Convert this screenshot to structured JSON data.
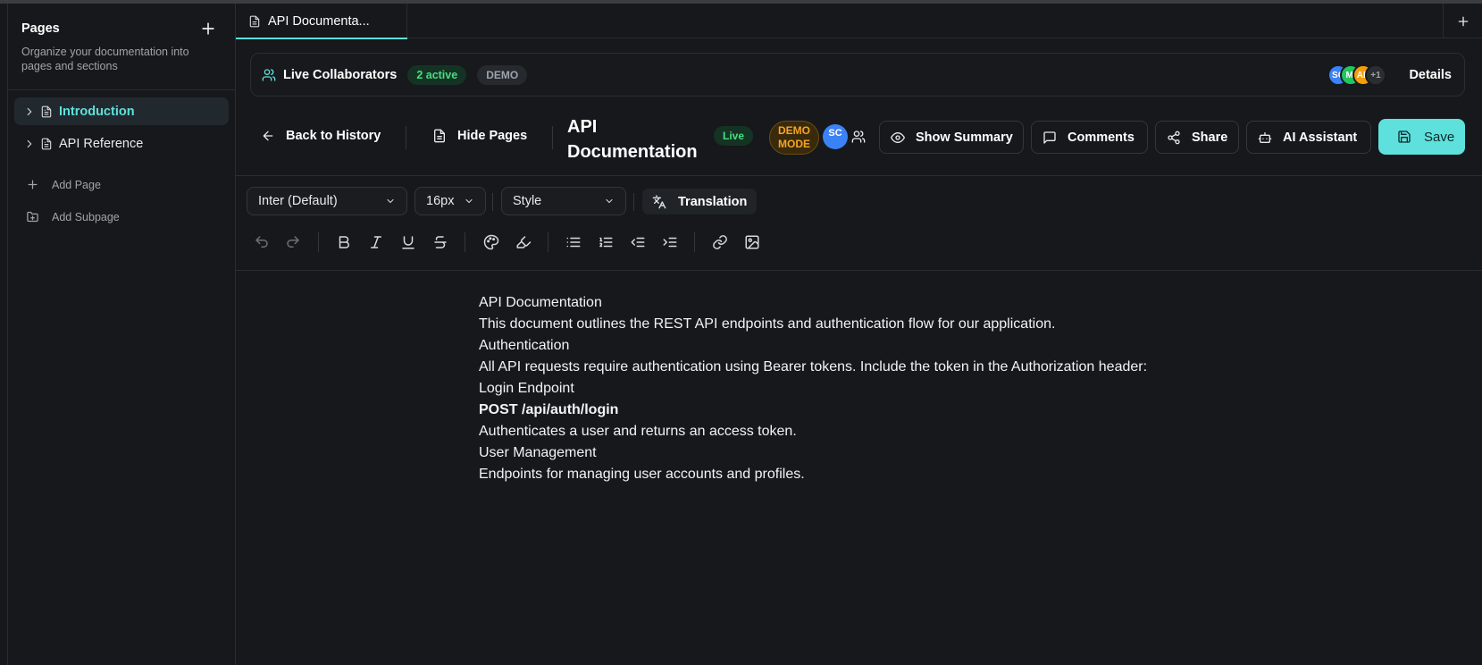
{
  "sidebar": {
    "title": "Pages",
    "description": "Organize your documentation into pages and sections",
    "pages": [
      {
        "label": "Introduction",
        "active": true
      },
      {
        "label": "API Reference",
        "active": false
      }
    ],
    "actions": {
      "add_page": "Add Page",
      "add_subpage": "Add Subpage"
    }
  },
  "tabs": [
    {
      "label": "API Documenta..."
    }
  ],
  "collaborators": {
    "title": "Live Collaborators",
    "active_badge": "2 active",
    "demo_badge": "DEMO",
    "avatars": [
      {
        "initials": "SC",
        "color": "#3b82f6"
      },
      {
        "initials": "MI",
        "color": "#22c55e"
      },
      {
        "initials": "AR",
        "color": "#f59e0b"
      }
    ],
    "more": "+1",
    "details_label": "Details"
  },
  "toolbar": {
    "back_label": "Back to History",
    "hide_pages_label": "Hide Pages",
    "doc_title": "API Documentation",
    "live_badge": "Live",
    "demo_mode_badge": "DEMO MODE",
    "me_initials": "SC",
    "show_summary_label": "Show Summary",
    "comments_label": "Comments",
    "share_label": "Share",
    "ai_assistant_label": "AI Assistant",
    "save_label": "Save"
  },
  "format": {
    "font_family": "Inter (Default)",
    "font_size": "16px",
    "style": "Style",
    "translation_label": "Translation"
  },
  "content": {
    "lines": [
      {
        "text": "API Documentation",
        "bold": false
      },
      {
        "text": "This document outlines the REST API endpoints and authentication flow for our application.",
        "bold": false
      },
      {
        "text": "Authentication",
        "bold": false
      },
      {
        "text": "All API requests require authentication using Bearer tokens. Include the token in the Authorization header:",
        "bold": false
      },
      {
        "text": "Login Endpoint",
        "bold": false
      },
      {
        "text": "POST /api/auth/login",
        "bold": true
      },
      {
        "text": "Authenticates a user and returns an access token.",
        "bold": false
      },
      {
        "text": "User Management",
        "bold": false
      },
      {
        "text": "Endpoints for managing user accounts and profiles.",
        "bold": false
      }
    ]
  },
  "colors": {
    "accent": "#5ee1dc",
    "background": "#16181b",
    "success": "#4ade80",
    "warning": "#f5a524"
  }
}
